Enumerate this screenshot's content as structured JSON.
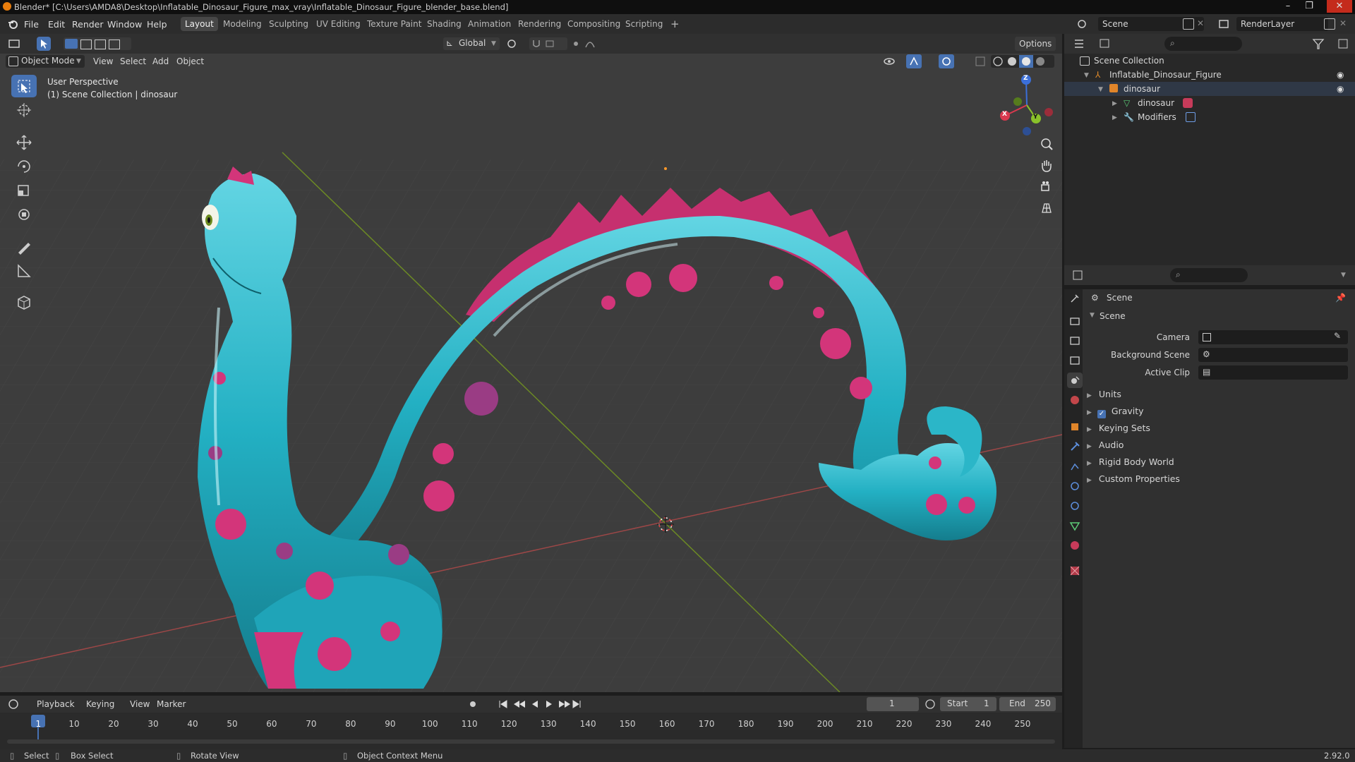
{
  "window": {
    "title": "Blender* [C:\\Users\\AMDA8\\Desktop\\Inflatable_Dinosaur_Figure_max_vray\\Inflatable_Dinosaur_Figure_blender_base.blend]",
    "minimize": "–",
    "maximize": "❐",
    "close": "✕"
  },
  "menubar": {
    "items": [
      "File",
      "Edit",
      "Render",
      "Window",
      "Help"
    ]
  },
  "workspaces": {
    "tabs": [
      "Layout",
      "Modeling",
      "Sculpting",
      "UV Editing",
      "Texture Paint",
      "Shading",
      "Animation",
      "Rendering",
      "Compositing",
      "Scripting"
    ],
    "active": "Layout",
    "add": "+"
  },
  "scene_selector": {
    "value": "Scene"
  },
  "view_layer": {
    "value": "RenderLayer"
  },
  "viewport_header": {
    "transform_orientation": "Global",
    "options": "Options",
    "mode": "Object Mode",
    "menus": [
      "View",
      "Select",
      "Add",
      "Object"
    ]
  },
  "viewport": {
    "perspective": "User Perspective",
    "collection": "(1) Scene Collection | dinosaur",
    "gizmo": {
      "x": "X",
      "y": "Y",
      "z": "Z"
    },
    "colors": {
      "grid_x": "#b04848",
      "grid_y": "#7a9a28",
      "body": "#2ab5c8",
      "spots": "#d73a7e",
      "background": "#3d3d3d"
    }
  },
  "outliner": {
    "root": "Scene Collection",
    "items": [
      {
        "label": "Inflatable_Dinosaur_Figure",
        "level": 1
      },
      {
        "label": "dinosaur",
        "level": 2
      },
      {
        "label": "dinosaur",
        "level": 3
      },
      {
        "label": "Modifiers",
        "level": 3
      }
    ]
  },
  "properties": {
    "header": "Scene",
    "panel": "Scene",
    "fields": [
      {
        "label": "Camera"
      },
      {
        "label": "Background Scene"
      },
      {
        "label": "Active Clip"
      }
    ],
    "sections": [
      "Units",
      "Gravity",
      "Keying Sets",
      "Audio",
      "Rigid Body World",
      "Custom Properties"
    ],
    "gravity_enabled": true
  },
  "timeline": {
    "menus": [
      "Playback",
      "Keying",
      "View",
      "Marker"
    ],
    "current_frame": "1",
    "start_label": "Start",
    "start": "1",
    "end_label": "End",
    "end": "250",
    "ticks": [
      "1",
      "10",
      "20",
      "30",
      "40",
      "50",
      "60",
      "70",
      "80",
      "90",
      "100",
      "110",
      "120",
      "130",
      "140",
      "150",
      "160",
      "170",
      "180",
      "190",
      "200",
      "210",
      "220",
      "230",
      "240",
      "250"
    ]
  },
  "statusbar": {
    "select": "Select",
    "box_select": "Box Select",
    "rotate_view": "Rotate View",
    "context_menu": "Object Context Menu",
    "version": "2.92.0"
  }
}
